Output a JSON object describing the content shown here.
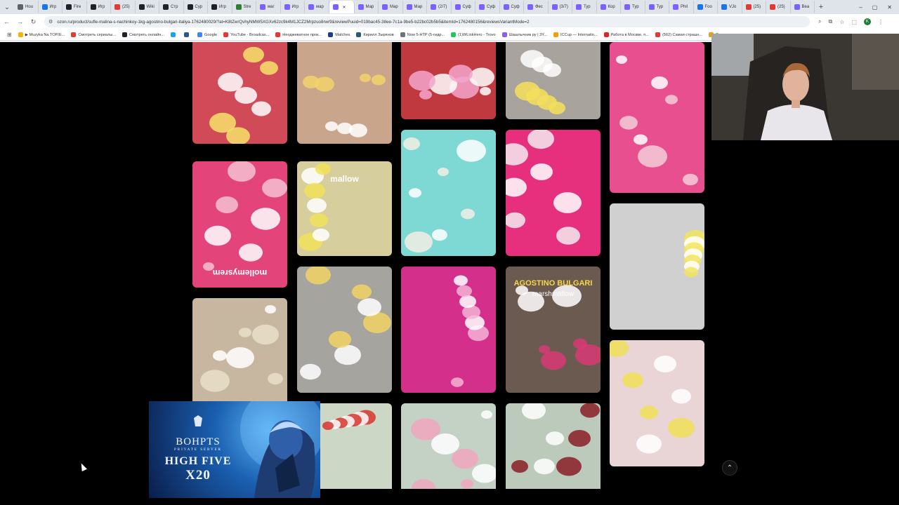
{
  "browser": {
    "tabs": [
      {
        "title": "Hou",
        "color": "#5f6368"
      },
      {
        "title": "Игр",
        "color": "#1a73e8"
      },
      {
        "title": "Fire",
        "color": "#202124"
      },
      {
        "title": "Игр",
        "color": "#202124"
      },
      {
        "title": "(25)",
        "color": "#e53935"
      },
      {
        "title": "Wiki",
        "color": "#202124"
      },
      {
        "title": "Стр",
        "color": "#202124"
      },
      {
        "title": "Сур",
        "color": "#202124"
      },
      {
        "title": "Игр",
        "color": "#202124"
      },
      {
        "title": "Stre",
        "color": "#2e7d32"
      },
      {
        "title": "маг",
        "color": "#7b61ff"
      },
      {
        "title": "Игр",
        "color": "#7b61ff"
      },
      {
        "title": "мар",
        "color": "#7b61ff"
      },
      {
        "title": "",
        "color": "#7b61ff",
        "active": true
      },
      {
        "title": "Мар",
        "color": "#7b61ff"
      },
      {
        "title": "Мар",
        "color": "#7b61ff"
      },
      {
        "title": "Мар",
        "color": "#7b61ff"
      },
      {
        "title": "(2/7)",
        "color": "#7b61ff"
      },
      {
        "title": "Суф",
        "color": "#7b61ff"
      },
      {
        "title": "Суф",
        "color": "#7b61ff"
      },
      {
        "title": "Суф",
        "color": "#7b61ff"
      },
      {
        "title": "Фес",
        "color": "#7b61ff"
      },
      {
        "title": "(3/7)",
        "color": "#7b61ff"
      },
      {
        "title": "Тур",
        "color": "#7b61ff"
      },
      {
        "title": "Кор",
        "color": "#7b61ff"
      },
      {
        "title": "Тур",
        "color": "#7b61ff"
      },
      {
        "title": "Тур",
        "color": "#7b61ff"
      },
      {
        "title": "Phil",
        "color": "#7b61ff"
      },
      {
        "title": "Foo",
        "color": "#1a73e8"
      },
      {
        "title": "VJo",
        "color": "#1a73e8"
      },
      {
        "title": "(25)",
        "color": "#e53935"
      },
      {
        "title": "(25)",
        "color": "#e53935"
      },
      {
        "title": "Bea",
        "color": "#7b61ff"
      }
    ],
    "url": "ozon.ru/product/sufle-malina-s-nachinkoy-1kg-agostino-bulgari-italiya-1762480029/?at=K8tZwrQvhyNMW5XGXv62zc9k4M1JCZ2Mrpzuo8rwr9&reviewPuuid=019bac45-38ee-7c1a-9be5-b22bc02b5b5&itemId=1762480156&reviewsVariantMode=2",
    "bookmarks": [
      {
        "label": "▶ Muzyka Na TOP/E...",
        "color": "#f5b400"
      },
      {
        "label": "Смотреть сериалы...",
        "color": "#e53935"
      },
      {
        "label": "Смотреть онлайн...",
        "color": "#202124"
      },
      {
        "label": "",
        "color": "#1da1f2"
      },
      {
        "label": "",
        "color": "#2a5885"
      },
      {
        "label": "Google",
        "color": "#4285f4"
      },
      {
        "label": "YouTube - Broadcas...",
        "color": "#e53935"
      },
      {
        "label": "Неоджеватное прок...",
        "color": "#e53935"
      },
      {
        "label": "Matches",
        "color": "#1e3a8a"
      },
      {
        "label": "Кирилл Зырянов",
        "color": "#2a5885"
      },
      {
        "label": "Now 5-HTP (5-гидр...",
        "color": "#6b7280"
      },
      {
        "label": "(1)WLinkHero - Trovo",
        "color": "#22c55e"
      },
      {
        "label": "Шашлычник ру | 3Y...",
        "color": "#8b5cf6"
      },
      {
        "label": "ICCup — Internatio...",
        "color": "#f59e0b"
      },
      {
        "label": "Работа в Москве, п...",
        "color": "#dc2626"
      },
      {
        "label": "(562) Самая страшн...",
        "color": "#e53935"
      },
      {
        "label": "Dro...",
        "color": "#f59e0b"
      }
    ]
  },
  "reviews_gallery": {
    "photos": [
      {
        "subject": "marshmallow flowers on plate",
        "bg": "#d14a57",
        "accent": "#f6e26a"
      },
      {
        "subject": "hand holding marshmallow",
        "bg": "#c9a58c",
        "accent": "#f3d26b"
      },
      {
        "subject": "marshmallow flowers close-up",
        "bg": "#c0393f",
        "accent": "#f3a6cc"
      },
      {
        "subject": "yellow banana marshmallow",
        "bg": "#a8a39c",
        "accent": "#f6e05a"
      },
      {
        "subject": "marshmallow bouquet pink",
        "bg": "#e84f8e",
        "accent": "#f5ccd8"
      },
      {
        "subject": "pink marshmallows in bag",
        "bg": "#e3457a",
        "accent": "#f6c1d2"
      },
      {
        "subject": "marshmallow bag yellow",
        "bg": "#d6cf9d",
        "accent": "#f1e25b"
      },
      {
        "subject": "marshmallow bouquet blue",
        "bg": "#7ed8d3",
        "accent": "#f3efe4"
      },
      {
        "subject": "marshmallow bouquet pink paper",
        "bg": "#e6307e",
        "accent": "#f3eaf0"
      },
      {
        "subject": "banana marshmallows plate",
        "bg": "#cfd0cf",
        "accent": "#f3e55d"
      },
      {
        "subject": "marshmallow bears wreath",
        "bg": "#c8b7a0",
        "accent": "#e9dfc8"
      },
      {
        "subject": "hand holding cut marshmallow",
        "bg": "#a5a49f",
        "accent": "#f2d464"
      },
      {
        "subject": "marshmallow package pink",
        "bg": "#d42f8a",
        "accent": "#f5b3d6"
      },
      {
        "subject": "agostino bulgari marshmallow bag",
        "bg": "#6b5a4f",
        "accent": "#d83b74"
      },
      {
        "subject": "banana marshmallows tray",
        "bg": "#e9d5d6",
        "accent": "#f1df58"
      },
      {
        "subject": "rose bouquet",
        "bg": "#cdd7c5",
        "accent": "#d6352e"
      },
      {
        "subject": "marshmallow flower bouquet",
        "bg": "#c3d2c5",
        "accent": "#f1a7be"
      },
      {
        "subject": "burgundy flower bouquet",
        "bg": "#bccabb",
        "accent": "#8a1f27"
      }
    ],
    "package_text": {
      "bag_brand": "AGOSTINO BULGARI",
      "bag_product": "marshmallow",
      "pink_bag_text": "mollemysrem",
      "yellow_bag_text": "mallow"
    }
  },
  "ad_banner": {
    "brand": "BOHPTS",
    "tagline": "PRIVATE SERVER",
    "headline": "HIGH FIVE",
    "rate": "X20"
  },
  "ui": {
    "scroll_top_icon": "chevron-up-icon",
    "cursor_icon": "arrow-cursor-icon"
  }
}
